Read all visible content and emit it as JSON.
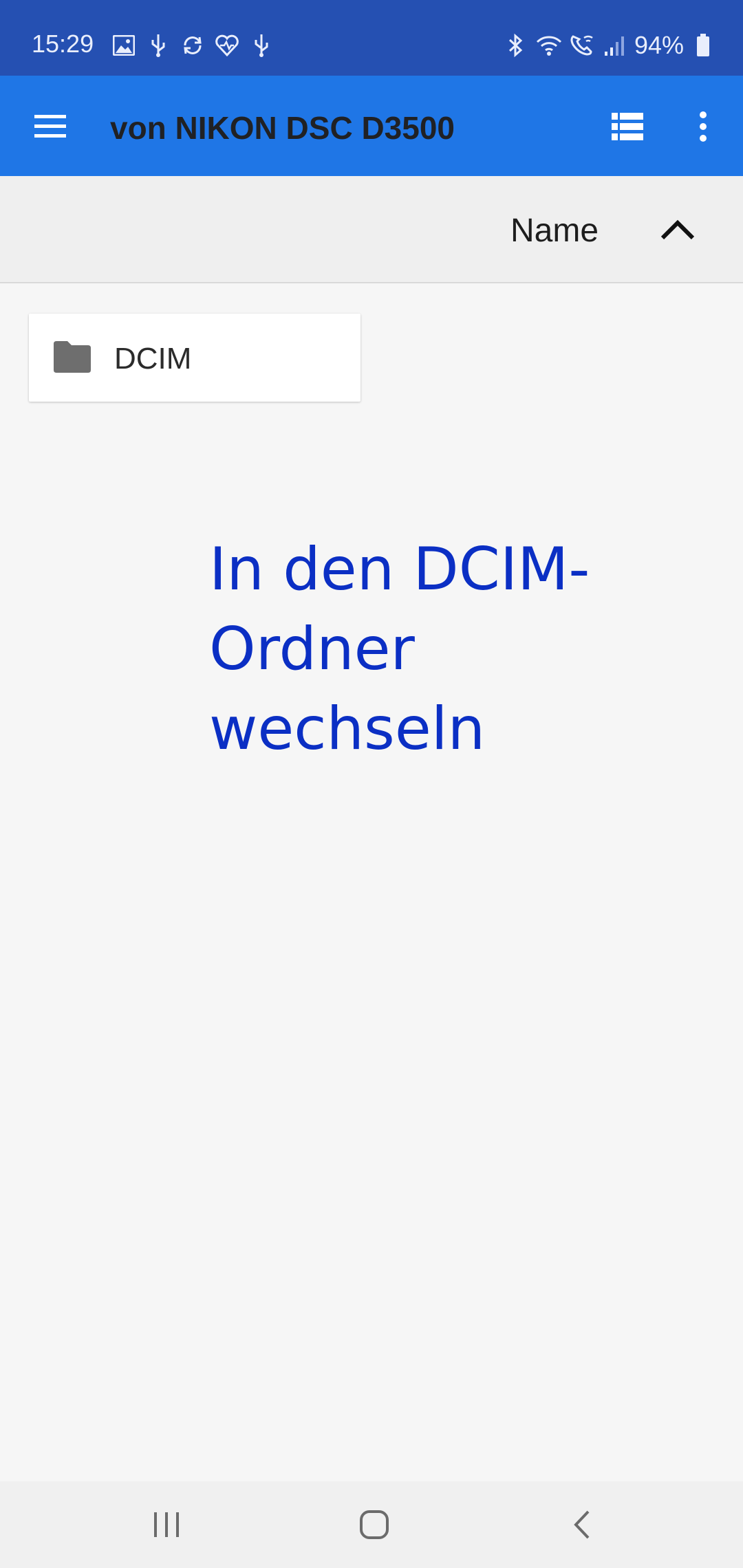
{
  "status_bar": {
    "time": "15:29",
    "battery": "94%",
    "icons_left": [
      "image-icon",
      "usb-icon",
      "sync-icon",
      "health-icon",
      "usb-icon"
    ],
    "icons_right": [
      "bluetooth-icon",
      "wifi-icon",
      "wifi-call-icon",
      "signal-icon",
      "battery-icon"
    ]
  },
  "app_bar": {
    "title": "von NIKON DSC D3500",
    "menu_icon": "hamburger-icon",
    "view_icon": "list-view-icon",
    "more_icon": "more-vert-icon"
  },
  "sort_header": {
    "label": "Name",
    "direction": "ascending",
    "direction_icon": "chevron-up-icon"
  },
  "files": [
    {
      "name": "DCIM",
      "type": "folder",
      "icon": "folder-icon"
    }
  ],
  "instruction": {
    "text": "In den DCIM-Ordner wechseln"
  },
  "nav_bar": {
    "buttons": [
      "recents-icon",
      "home-icon",
      "back-icon"
    ]
  },
  "colors": {
    "status_bar_bg": "#2550b2",
    "app_bar_bg": "#1f76e6",
    "instruction_text": "#0b2fc4",
    "background": "#f6f6f6"
  }
}
